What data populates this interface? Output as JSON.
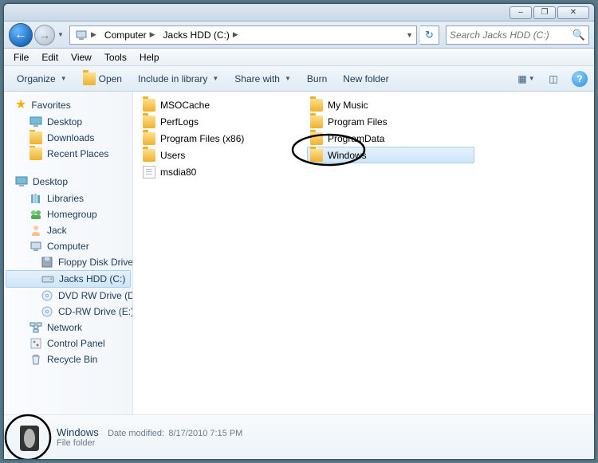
{
  "titlebar": {
    "min": "–",
    "max": "❐",
    "close": "✕"
  },
  "nav": {
    "back": "←",
    "forward": "→",
    "dropdown": "▼",
    "refresh": "↻"
  },
  "breadcrumb": [
    {
      "label": "",
      "icon": "computer"
    },
    {
      "label": "Computer"
    },
    {
      "label": "Jacks HDD (C:)"
    }
  ],
  "search": {
    "placeholder": "Search Jacks HDD (C:)"
  },
  "menus": [
    "File",
    "Edit",
    "View",
    "Tools",
    "Help"
  ],
  "toolbar": {
    "organize": "Organize",
    "open": "Open",
    "include": "Include in library",
    "share": "Share with",
    "burn": "Burn",
    "newfolder": "New folder"
  },
  "sidebar": {
    "favorites": {
      "title": "Favorites",
      "items": [
        "Desktop",
        "Downloads",
        "Recent Places"
      ]
    },
    "desktop": {
      "title": "Desktop",
      "items": [
        "Libraries",
        "Homegroup",
        "Jack",
        "Computer"
      ],
      "computer_children": [
        "Floppy Disk Drive (",
        "Jacks HDD (C:)",
        "DVD RW Drive (D:)",
        "CD-RW Drive (E:)"
      ],
      "after": [
        "Network",
        "Control Panel",
        "Recycle Bin"
      ]
    }
  },
  "files": {
    "col1": [
      {
        "name": "MSOCache",
        "type": "folder"
      },
      {
        "name": "PerfLogs",
        "type": "folder"
      },
      {
        "name": "Program Files (x86)",
        "type": "folder"
      },
      {
        "name": "Users",
        "type": "folder"
      },
      {
        "name": "msdia80",
        "type": "file"
      }
    ],
    "col2": [
      {
        "name": "My Music",
        "type": "folder"
      },
      {
        "name": "Program Files",
        "type": "folder"
      },
      {
        "name": "ProgramData",
        "type": "folder"
      },
      {
        "name": "Windows",
        "type": "folder",
        "selected": true
      }
    ]
  },
  "details": {
    "name": "Windows",
    "meta_label": "Date modified:",
    "meta_value": "8/17/2010 7:15 PM",
    "type": "File folder"
  }
}
